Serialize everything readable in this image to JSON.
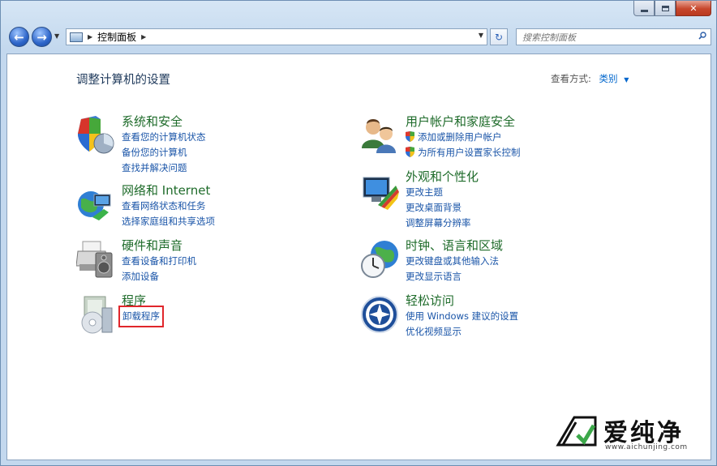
{
  "window": {
    "caption": {
      "minimize": "",
      "maximize": "",
      "close": "✕"
    }
  },
  "nav": {
    "breadcrumb": "控制面板",
    "search_placeholder": "搜索控制面板"
  },
  "header": {
    "title": "调整计算机的设置",
    "view_by_label": "查看方式:",
    "view_by_value": "类别"
  },
  "categories": {
    "system_security": {
      "title": "系统和安全",
      "links": [
        "查看您的计算机状态",
        "备份您的计算机",
        "查找并解决问题"
      ]
    },
    "network": {
      "title": "网络和 Internet",
      "links": [
        "查看网络状态和任务",
        "选择家庭组和共享选项"
      ]
    },
    "hardware": {
      "title": "硬件和声音",
      "links": [
        "查看设备和打印机",
        "添加设备"
      ]
    },
    "programs": {
      "title": "程序",
      "links": [
        "卸载程序"
      ]
    },
    "user_accounts": {
      "title": "用户帐户和家庭安全",
      "links": [
        "添加或删除用户帐户",
        "为所有用户设置家长控制"
      ]
    },
    "appearance": {
      "title": "外观和个性化",
      "links": [
        "更改主题",
        "更改桌面背景",
        "调整屏幕分辨率"
      ]
    },
    "clock_region": {
      "title": "时钟、语言和区域",
      "links": [
        "更改键盘或其他输入法",
        "更改显示语言"
      ]
    },
    "ease_access": {
      "title": "轻松访问",
      "links": [
        "使用 Windows 建议的设置",
        "优化视频显示"
      ]
    }
  },
  "watermark": {
    "text": "爱纯净",
    "url": "www.aichunjing.com"
  },
  "colors": {
    "category_title": "#1e6b2a",
    "link": "#1a55a8",
    "highlight": "#e0262b"
  }
}
